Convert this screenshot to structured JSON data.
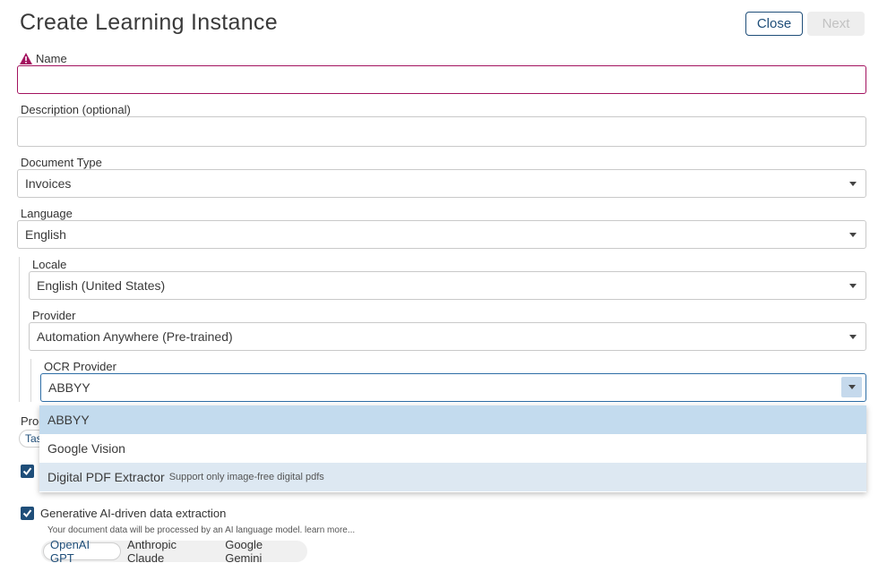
{
  "dialog": {
    "title": "Create Learning Instance",
    "close_label": "Close",
    "next_label": "Next"
  },
  "form": {
    "name": {
      "label": "Name",
      "value": "",
      "state": "error"
    },
    "description": {
      "label": "Description (optional)",
      "value": ""
    },
    "document_type": {
      "label": "Document Type",
      "value": "Invoices"
    },
    "language": {
      "label": "Language",
      "value": "English"
    },
    "locale": {
      "label": "Locale",
      "value": "English (United States)"
    },
    "provider": {
      "label": "Provider",
      "value": "Automation Anywhere (Pre-trained)"
    },
    "ocr_provider": {
      "label": "OCR Provider",
      "value": "ABBYY",
      "options": [
        {
          "label": "ABBYY",
          "note": ""
        },
        {
          "label": "Google Vision",
          "note": ""
        },
        {
          "label": "Digital PDF Extractor",
          "note": "Support only image-free digital pdfs"
        }
      ]
    },
    "hidden_label_fragment": "Proc",
    "hidden_pill_fragment": "Tas"
  },
  "gen_ai": {
    "label": "Generative AI-driven data extraction",
    "checked": true,
    "note": "Your document data will be processed by an AI language model. learn more...",
    "models": [
      "OpenAI GPT",
      "Anthropic Claude",
      "Google Gemini"
    ],
    "selected_model": "OpenAI GPT"
  },
  "colors": {
    "accent": "#1f4e79",
    "error": "#a3125f",
    "selected_option": "#c3dbee"
  }
}
